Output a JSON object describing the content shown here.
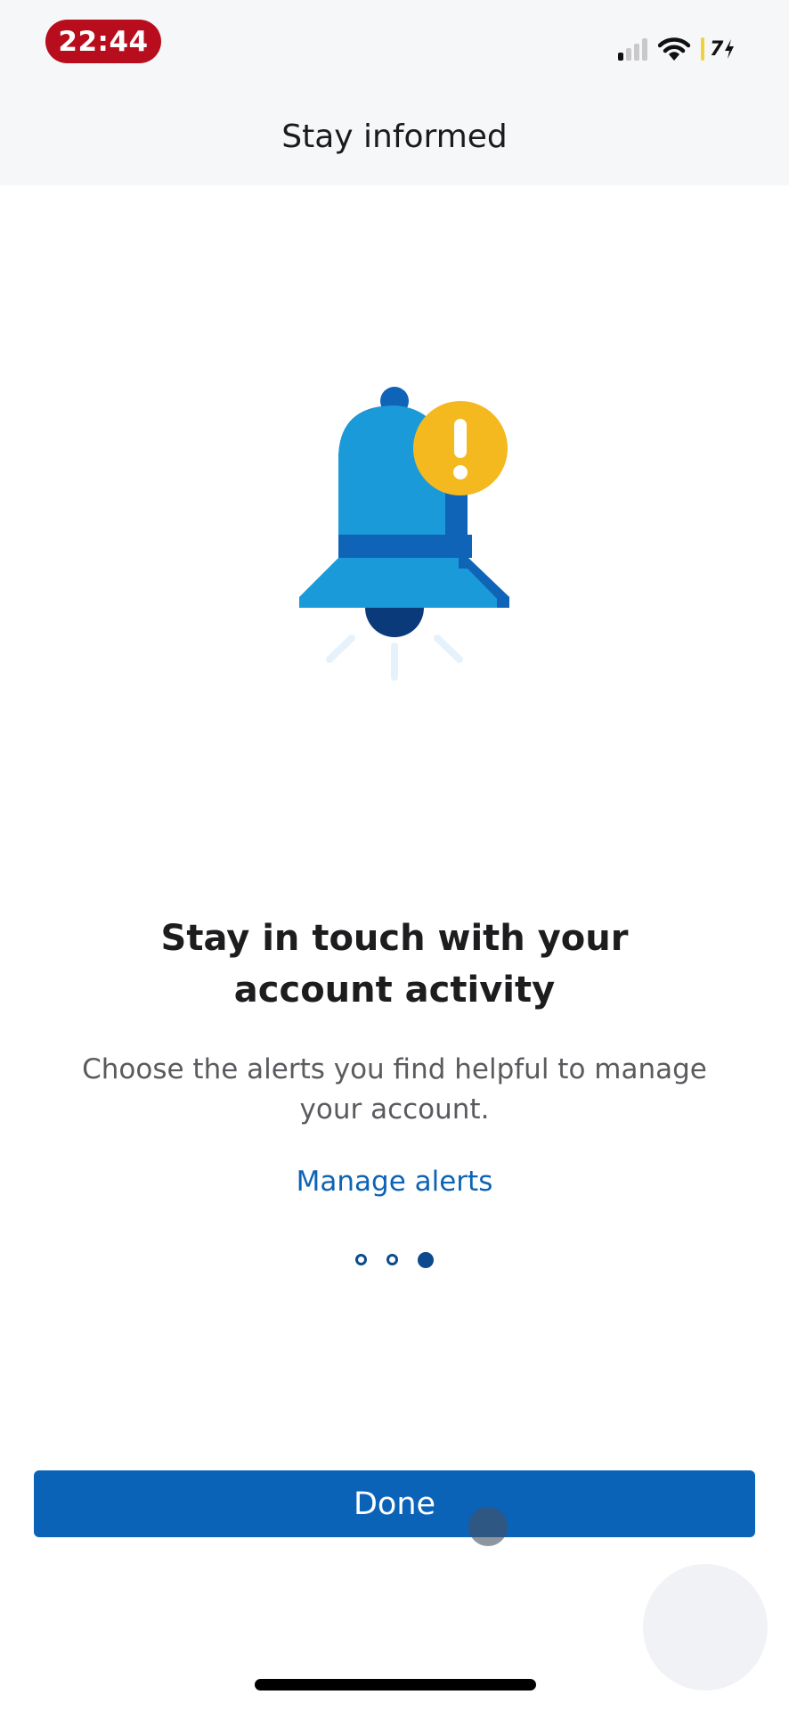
{
  "status_bar": {
    "time": "22:44",
    "signal_bars_active": 1,
    "signal_bars_total": 4,
    "wifi_icon": "wifi-icon",
    "battery_level": "7",
    "charging_icon": "bolt-icon",
    "colors": {
      "time_pill": "#b80d1c",
      "battery_indicator": "#f1d23a"
    }
  },
  "nav": {
    "title": "Stay informed"
  },
  "illustration": {
    "icon": "bell-alert-icon",
    "badge_glyph": "!",
    "colors": {
      "bell_light": "#1a9ad9",
      "bell_dark": "#0f64b8",
      "clapper": "#0a3a7a",
      "badge": "#f4b91e"
    }
  },
  "content": {
    "heading_line1": "Stay in touch with your",
    "heading_line2": "account activity",
    "body_line1": "Choose the alerts you find helpful to manage",
    "body_line2": "your account.",
    "link": "Manage alerts"
  },
  "pager": {
    "total": 3,
    "current": 3
  },
  "footer": {
    "done_label": "Done"
  },
  "colors": {
    "accent": "#0b63b8",
    "link": "#0d63b6",
    "pager": "#0b4a8c"
  }
}
